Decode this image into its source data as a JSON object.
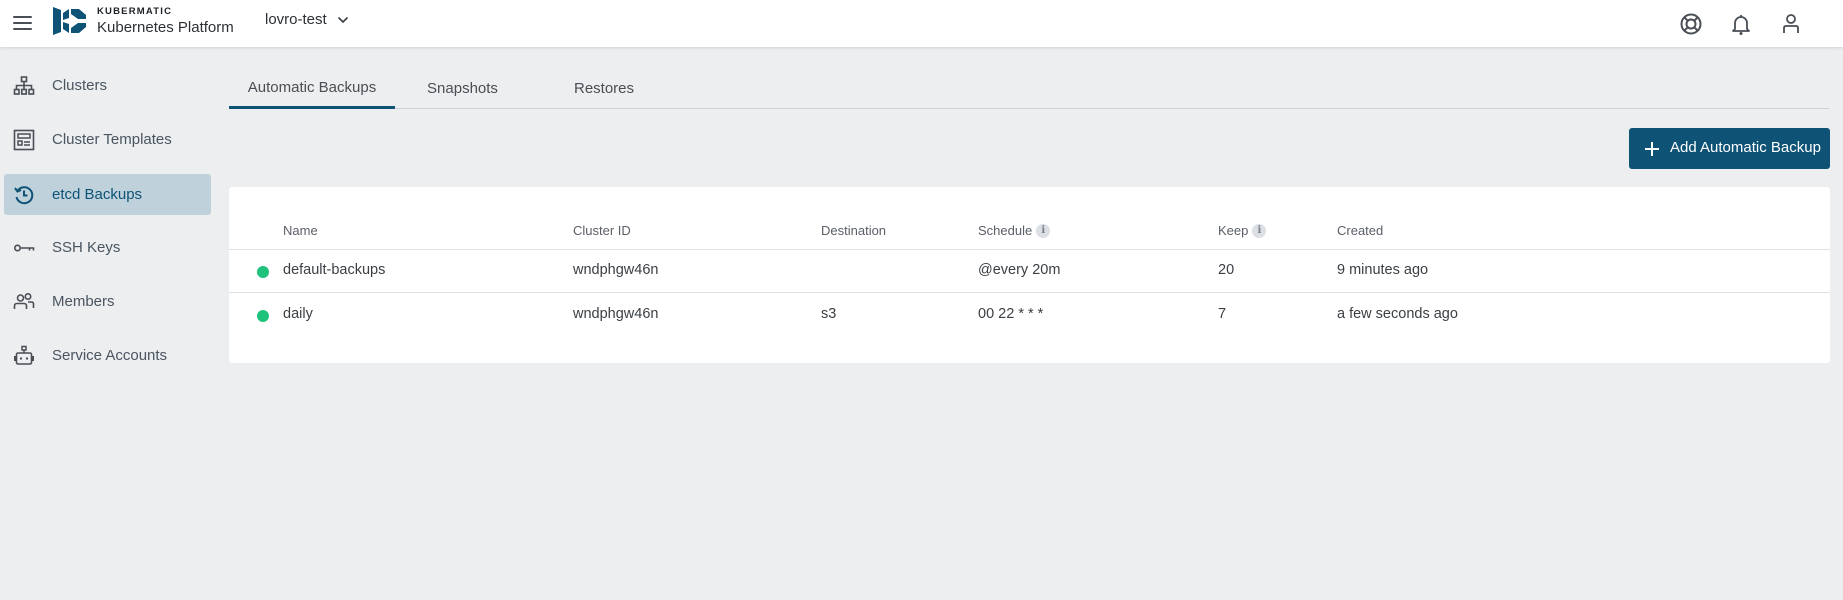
{
  "app": {
    "brand_top": "KUBERMATIC",
    "brand_bottom": "Kubernetes Platform",
    "project": "lovro-test",
    "accent_color": "#0e5275",
    "status_color": "#1fc27b"
  },
  "topbar": {
    "icons": [
      "help-lifebuoy-icon",
      "notifications-bell-icon",
      "account-user-icon"
    ]
  },
  "sidebar": {
    "items": [
      {
        "label": "Clusters",
        "icon": "cluster-tree-icon",
        "active": false
      },
      {
        "label": "Cluster Templates",
        "icon": "template-icon",
        "active": false
      },
      {
        "label": "etcd Backups",
        "icon": "history-icon",
        "active": true
      },
      {
        "label": "SSH Keys",
        "icon": "key-icon",
        "active": false
      },
      {
        "label": "Members",
        "icon": "members-icon",
        "active": false
      },
      {
        "label": "Service Accounts",
        "icon": "robot-icon",
        "active": false
      }
    ]
  },
  "tabs": [
    {
      "label": "Automatic Backups",
      "active": true
    },
    {
      "label": "Snapshots",
      "active": false
    },
    {
      "label": "Restores",
      "active": false
    }
  ],
  "toolbar": {
    "add_label": "Add Automatic Backup"
  },
  "table": {
    "columns": [
      "Name",
      "Cluster ID",
      "Destination",
      "Schedule",
      "Keep",
      "Created"
    ],
    "rows": [
      {
        "status": "healthy",
        "name": "default-backups",
        "cluster_id": "wndphgw46n",
        "destination": "",
        "schedule": "@every 20m",
        "keep": "20",
        "created": "9 minutes ago"
      },
      {
        "status": "healthy",
        "name": "daily",
        "cluster_id": "wndphgw46n",
        "destination": "s3",
        "schedule": "00 22 * * *",
        "keep": "7",
        "created": "a few seconds ago"
      }
    ]
  }
}
